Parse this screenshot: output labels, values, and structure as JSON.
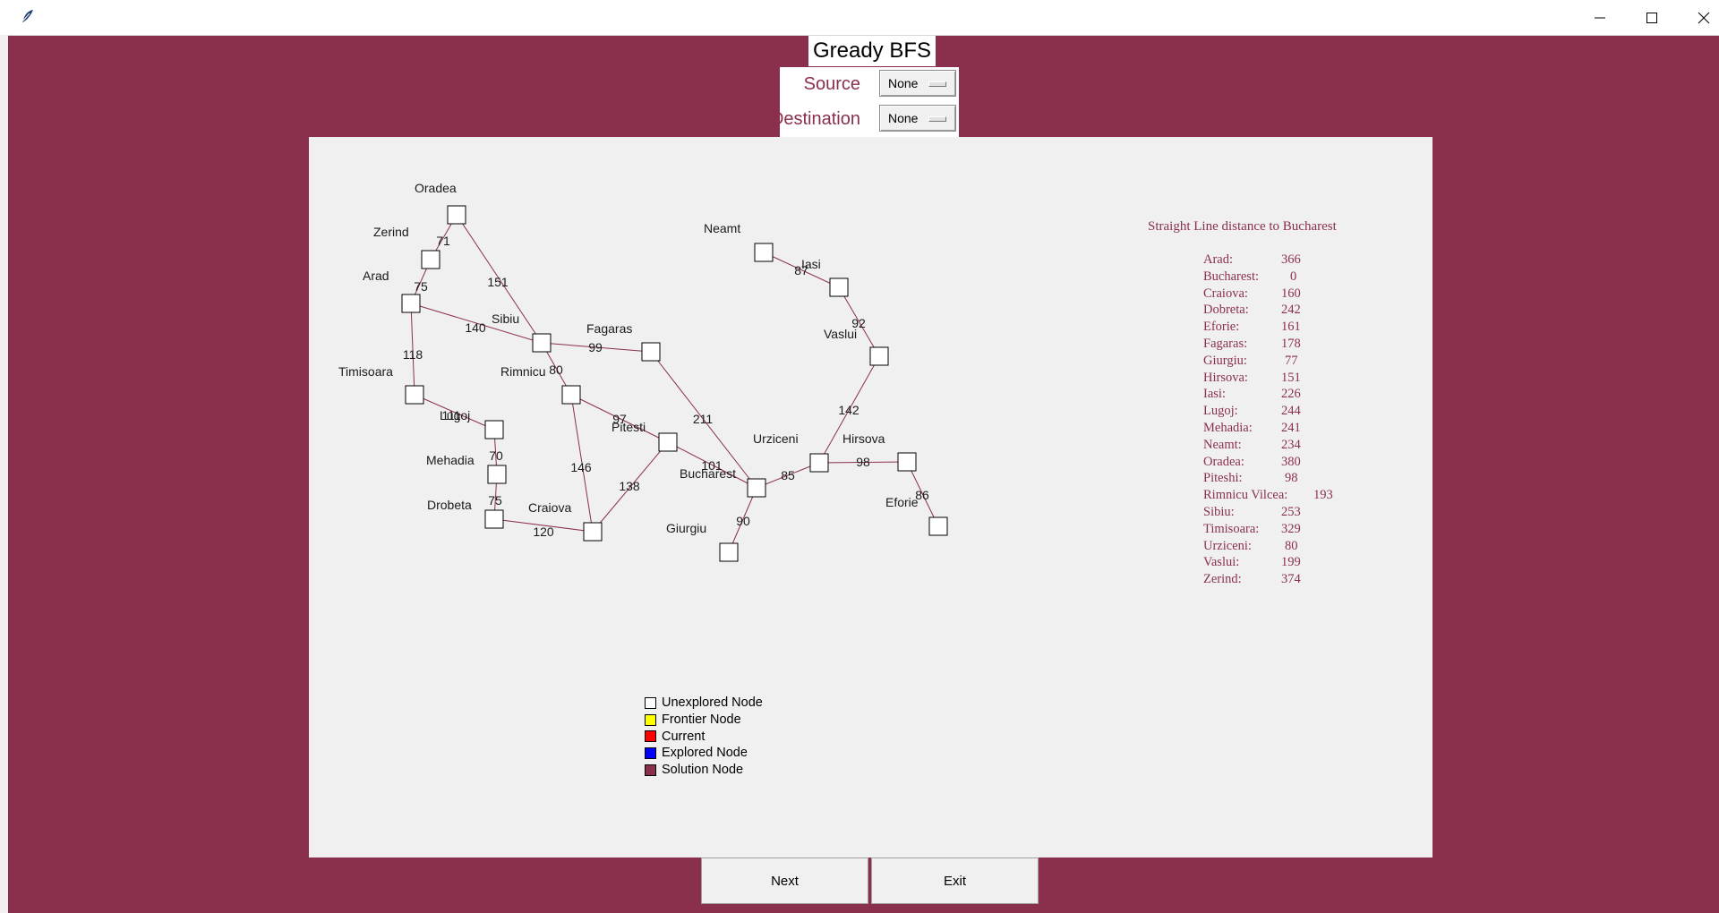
{
  "window": {
    "title": "",
    "controls": {
      "minimize": "minimize-icon",
      "maximize": "maximize-icon",
      "close": "close-icon"
    }
  },
  "header": {
    "title": "Gready BFS"
  },
  "form": {
    "source_label": "Source",
    "source_value": "None",
    "destination_label": "Destination",
    "destination_value": "None"
  },
  "graph": {
    "cities": [
      {
        "name": "Oradea"
      },
      {
        "name": "Zerind"
      },
      {
        "name": "Arad"
      },
      {
        "name": "Timisoara"
      },
      {
        "name": "Lugoj"
      },
      {
        "name": "Mehadia"
      },
      {
        "name": "Drobeta"
      },
      {
        "name": "Craiova"
      },
      {
        "name": "Sibiu"
      },
      {
        "name": "Rimnicu"
      },
      {
        "name": "Fagaras"
      },
      {
        "name": "Pitesti"
      },
      {
        "name": "Bucharest"
      },
      {
        "name": "Giurgiu"
      },
      {
        "name": "Urziceni"
      },
      {
        "name": "Hirsova"
      },
      {
        "name": "Eforie"
      },
      {
        "name": "Vaslui"
      },
      {
        "name": "Iasi"
      },
      {
        "name": "Neamt"
      }
    ],
    "roads": [
      {
        "a": "Oradea",
        "b": "Zerind",
        "km": "71"
      },
      {
        "a": "Oradea",
        "b": "Sibiu",
        "km": "151"
      },
      {
        "a": "Zerind",
        "b": "Arad",
        "km": "75"
      },
      {
        "a": "Arad",
        "b": "Sibiu",
        "km": "140"
      },
      {
        "a": "Arad",
        "b": "Timisoara",
        "km": "118"
      },
      {
        "a": "Timisoara",
        "b": "Lugoj",
        "km": "111"
      },
      {
        "a": "Lugoj",
        "b": "Mehadia",
        "km": "70"
      },
      {
        "a": "Mehadia",
        "b": "Drobeta",
        "km": "75"
      },
      {
        "a": "Drobeta",
        "b": "Craiova",
        "km": "120"
      },
      {
        "a": "Sibiu",
        "b": "Fagaras",
        "km": "99"
      },
      {
        "a": "Sibiu",
        "b": "Rimnicu",
        "km": "80"
      },
      {
        "a": "Rimnicu",
        "b": "Pitesti",
        "km": "97"
      },
      {
        "a": "Rimnicu",
        "b": "Craiova",
        "km": "146"
      },
      {
        "a": "Craiova",
        "b": "Pitesti",
        "km": "138"
      },
      {
        "a": "Pitesti",
        "b": "Bucharest",
        "km": "101"
      },
      {
        "a": "Fagaras",
        "b": "Bucharest",
        "km": "211"
      },
      {
        "a": "Bucharest",
        "b": "Giurgiu",
        "km": "90"
      },
      {
        "a": "Bucharest",
        "b": "Urziceni",
        "km": "85"
      },
      {
        "a": "Urziceni",
        "b": "Hirsova",
        "km": "98"
      },
      {
        "a": "Hirsova",
        "b": "Eforie",
        "km": "86"
      },
      {
        "a": "Urziceni",
        "b": "Vaslui",
        "km": "142"
      },
      {
        "a": "Vaslui",
        "b": "Iasi",
        "km": "92"
      },
      {
        "a": "Iasi",
        "b": "Neamt",
        "km": "87"
      }
    ]
  },
  "sld": {
    "title": "Straight Line distance to Bucharest",
    "rows": [
      {
        "city": "Arad:",
        "dist": "366"
      },
      {
        "city": "Bucharest:",
        "dist": "0"
      },
      {
        "city": "Craiova:",
        "dist": "160"
      },
      {
        "city": "Dobreta:",
        "dist": "242"
      },
      {
        "city": "Eforie:",
        "dist": "161"
      },
      {
        "city": "Fagaras:",
        "dist": "178"
      },
      {
        "city": "Giurgiu:",
        "dist": "77"
      },
      {
        "city": "Hirsova:",
        "dist": "151"
      },
      {
        "city": "Iasi:",
        "dist": "226"
      },
      {
        "city": "Lugoj:",
        "dist": "244"
      },
      {
        "city": "Mehadia:",
        "dist": "241"
      },
      {
        "city": "Neamt:",
        "dist": "234"
      },
      {
        "city": "Oradea:",
        "dist": "380"
      },
      {
        "city": "Piteshi:",
        "dist": "98"
      },
      {
        "city": "Rimnicu Vilcea:",
        "dist": "193"
      },
      {
        "city": "Sibiu:",
        "dist": "253"
      },
      {
        "city": "Timisoara:",
        "dist": "329"
      },
      {
        "city": "Urziceni:",
        "dist": "80"
      },
      {
        "city": "Vaslui:",
        "dist": "199"
      },
      {
        "city": "Zerind:",
        "dist": "374"
      }
    ]
  },
  "legend": {
    "items": [
      {
        "label": "Unexplored Node",
        "color": "#ffffff"
      },
      {
        "label": "Frontier Node",
        "color": "#ffff00"
      },
      {
        "label": "Current",
        "color": "#ff0000"
      },
      {
        "label": "Explored Node",
        "color": "#0000ff"
      },
      {
        "label": "Solution Node",
        "color": "#8b304c"
      }
    ]
  },
  "buttons": {
    "next": "Next",
    "exit": "Exit"
  },
  "colors": {
    "background": "#8b304c",
    "edge": "#8b304c",
    "canvas": "#f0f0f0"
  }
}
